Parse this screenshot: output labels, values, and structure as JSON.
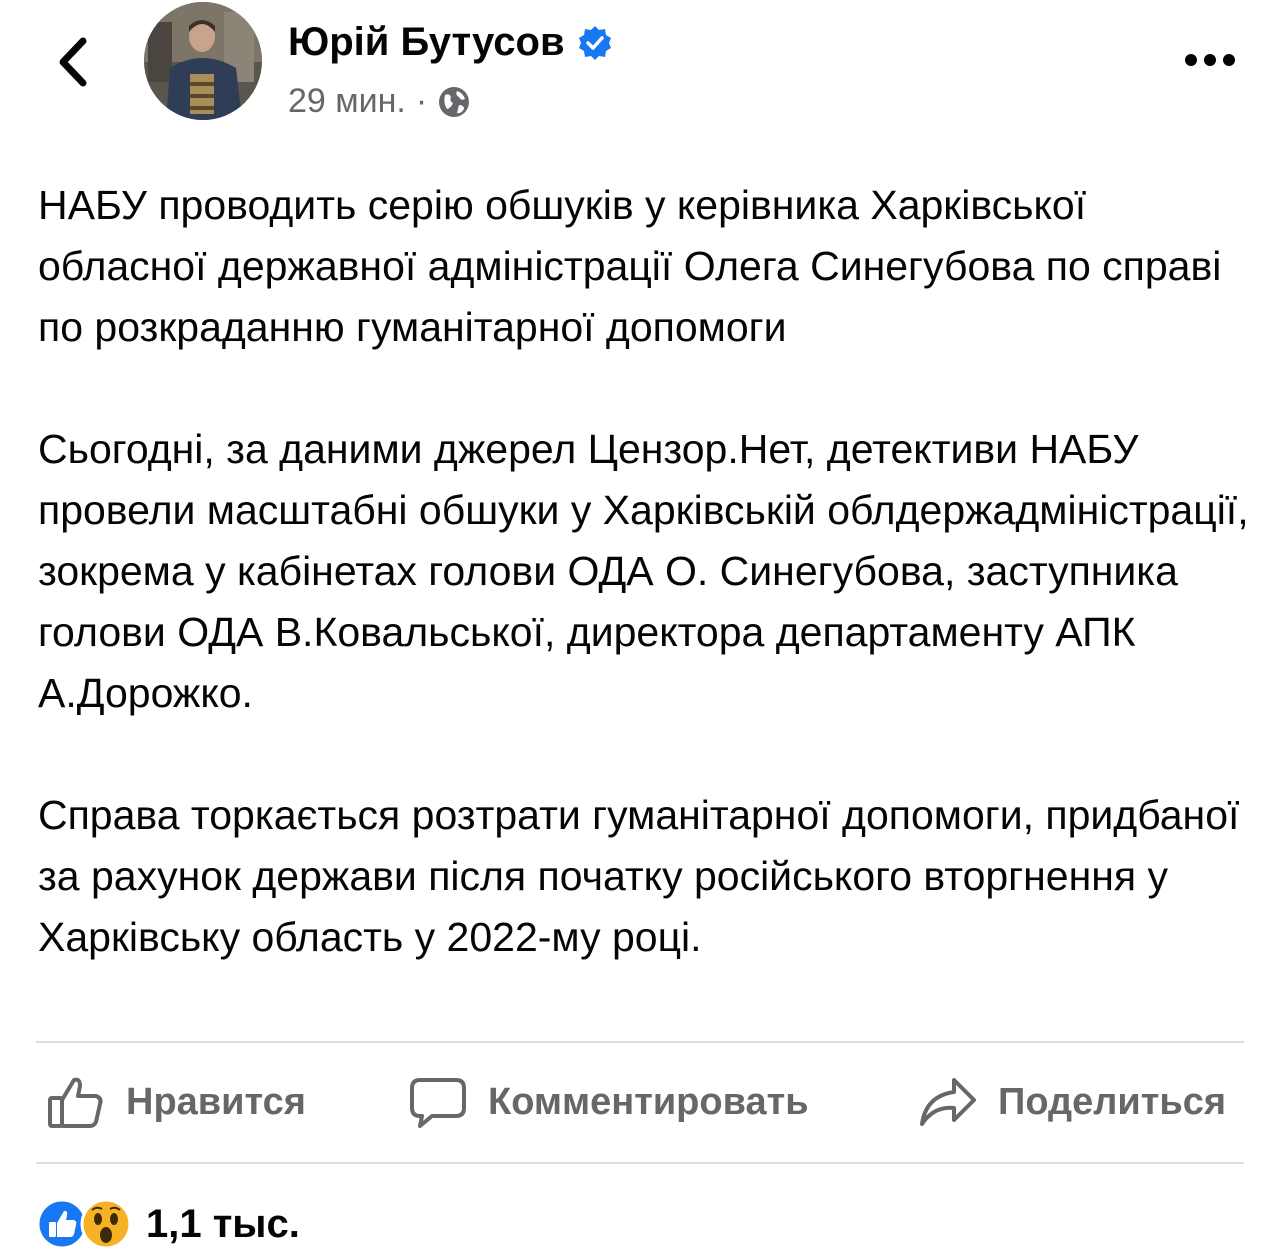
{
  "header": {
    "author_name": "Юрій Бутусов",
    "timestamp": "29 мин.",
    "separator": "·",
    "icons": {
      "back": "chevron-left-icon",
      "verified": "verified-badge-icon",
      "privacy": "globe-icon",
      "more": "more-dots-icon"
    }
  },
  "post": {
    "paragraphs": [
      "НАБУ проводить серію обшуків у керівника Харківської обласної державної адміністрації Олега Синегубова по справі по розкраданню гуманітарної допомоги",
      "Сьогодні, за даними джерел Цензор.Нет,  детективи НАБУ провели масштабні обшуки у Харківській облдержадміністрації, зокрема у кабінетах голови ОДА О. Синегубова, заступника голови ОДА В.Ковальської, директора департаменту АПК А.Дорожко.",
      "Справа торкається розтрати гуманітарної допомоги, придбаної за рахунок держави після початку російського вторгнення у Харківську область у 2022-му році."
    ]
  },
  "actions": {
    "like_label": "Нравится",
    "comment_label": "Комментировать",
    "share_label": "Поделиться"
  },
  "reactions": {
    "count": "1,1 тыс.",
    "types": [
      "like",
      "wow"
    ]
  },
  "colors": {
    "verified_blue": "#1877f2",
    "secondary_text": "#65676b",
    "divider": "#dadde1",
    "wow_yellow": "#f7b125"
  }
}
